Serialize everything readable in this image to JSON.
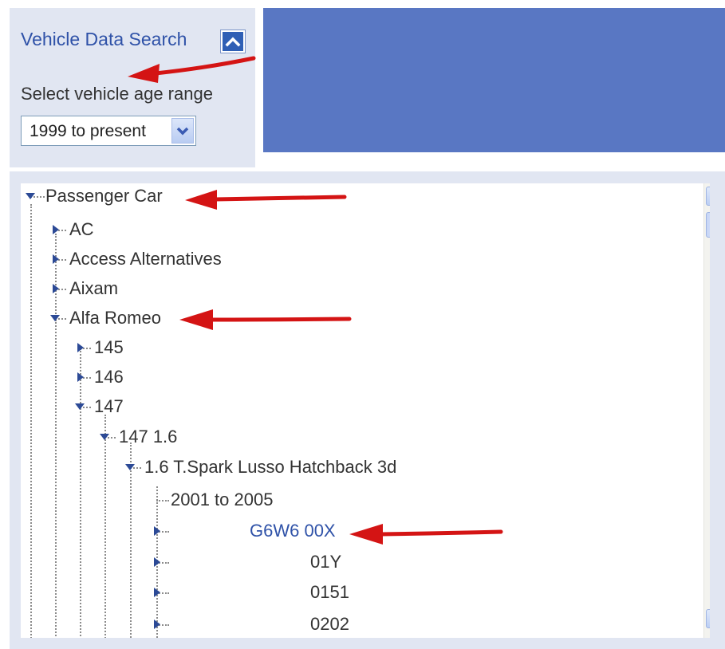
{
  "search_panel": {
    "title": "Vehicle Data Search",
    "age_label": "Select vehicle age range",
    "age_select_value": "1999 to present"
  },
  "tree": {
    "nodes": [
      {
        "label": "Passenger Car",
        "state": "expanded"
      },
      {
        "label": "AC",
        "state": "collapsed"
      },
      {
        "label": "Access Alternatives",
        "state": "collapsed"
      },
      {
        "label": "Aixam",
        "state": "collapsed"
      },
      {
        "label": "Alfa Romeo",
        "state": "expanded"
      },
      {
        "label": "145",
        "state": "collapsed"
      },
      {
        "label": "146",
        "state": "collapsed"
      },
      {
        "label": "147",
        "state": "expanded"
      },
      {
        "label": "147 1.6",
        "state": "expanded"
      },
      {
        "label": "1.6 T.Spark Lusso Hatchback 3d",
        "state": "expanded"
      },
      {
        "label": "2001 to 2005",
        "state": "leaf"
      },
      {
        "label": "G6W6 00X",
        "state": "collapsed",
        "highlight": true
      },
      {
        "label": "01Y",
        "state": "collapsed"
      },
      {
        "label": "0151",
        "state": "collapsed"
      },
      {
        "label": "0202",
        "state": "collapsed"
      }
    ]
  },
  "colors": {
    "panel_bg": "#e1e6f2",
    "banner": "#5977c3",
    "link": "#2f52a8",
    "annotation_arrow": "#d41414"
  },
  "icons": {
    "collapse": "chevron-up-icon",
    "dropdown": "chevron-down-icon",
    "expanded": "triangle-down-icon",
    "collapsed": "triangle-right-icon"
  }
}
